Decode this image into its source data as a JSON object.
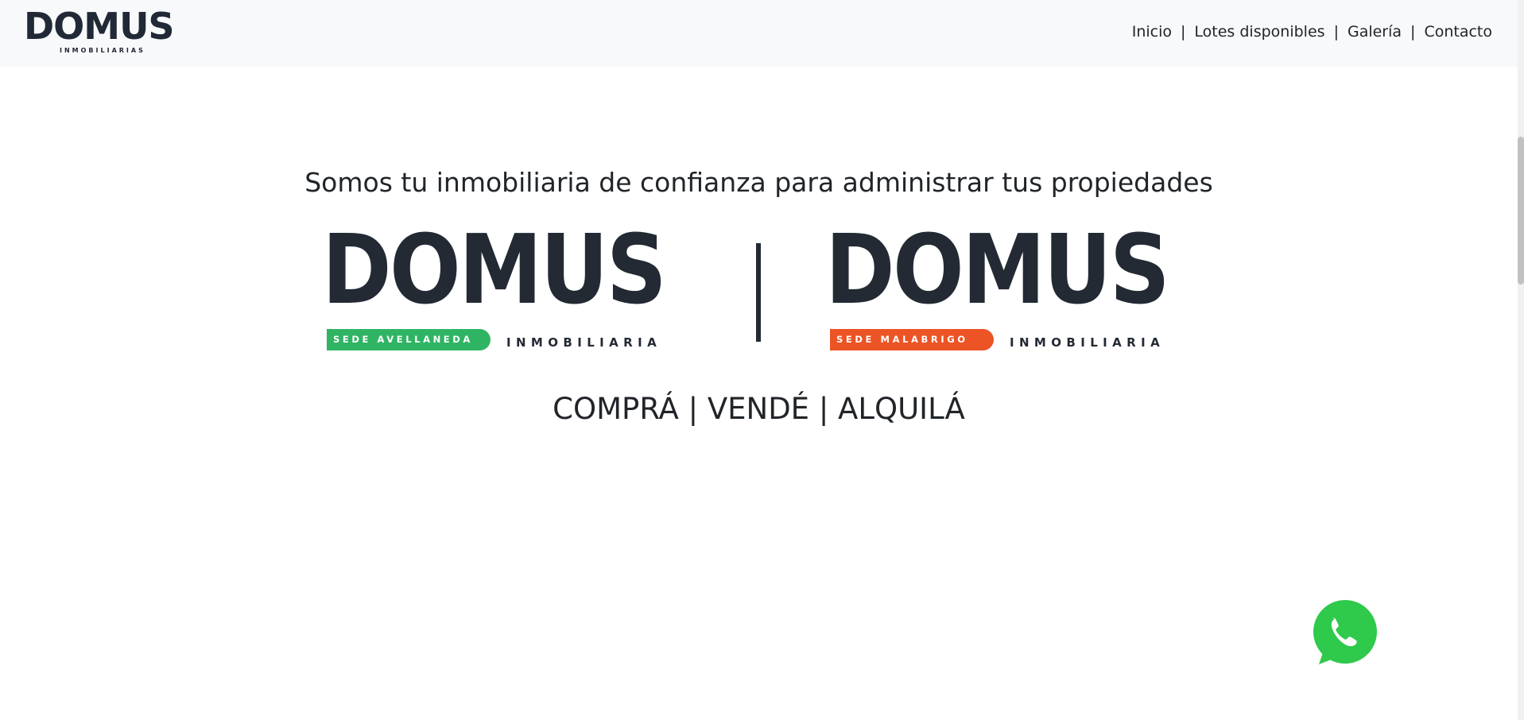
{
  "navbar": {
    "logo": {
      "word": "DOMUS",
      "subtitle": "INMOBILIARIAS"
    },
    "links": [
      {
        "label": "Inicio"
      },
      {
        "label": "Lotes disponibles"
      },
      {
        "label": "Galería"
      },
      {
        "label": "Contacto"
      }
    ],
    "separator": "|"
  },
  "main": {
    "tagline": "Somos tu inmobiliaria de confianza para administrar tus propiedades",
    "brands": [
      {
        "word": "DOMUS",
        "sede": "SEDE AVELLANEDA",
        "subtitle": "INMOBILIARIA",
        "color": "#2fb464"
      },
      {
        "word": "DOMUS",
        "sede": "SEDE MALABRIGO",
        "subtitle": "INMOBILIARIA",
        "color": "#ec5325"
      }
    ],
    "cta": "COMPRÁ | VENDÉ | ALQUILÁ"
  },
  "floating": {
    "whatsapp_icon": "whatsapp-icon",
    "color": "#2fc94b"
  }
}
